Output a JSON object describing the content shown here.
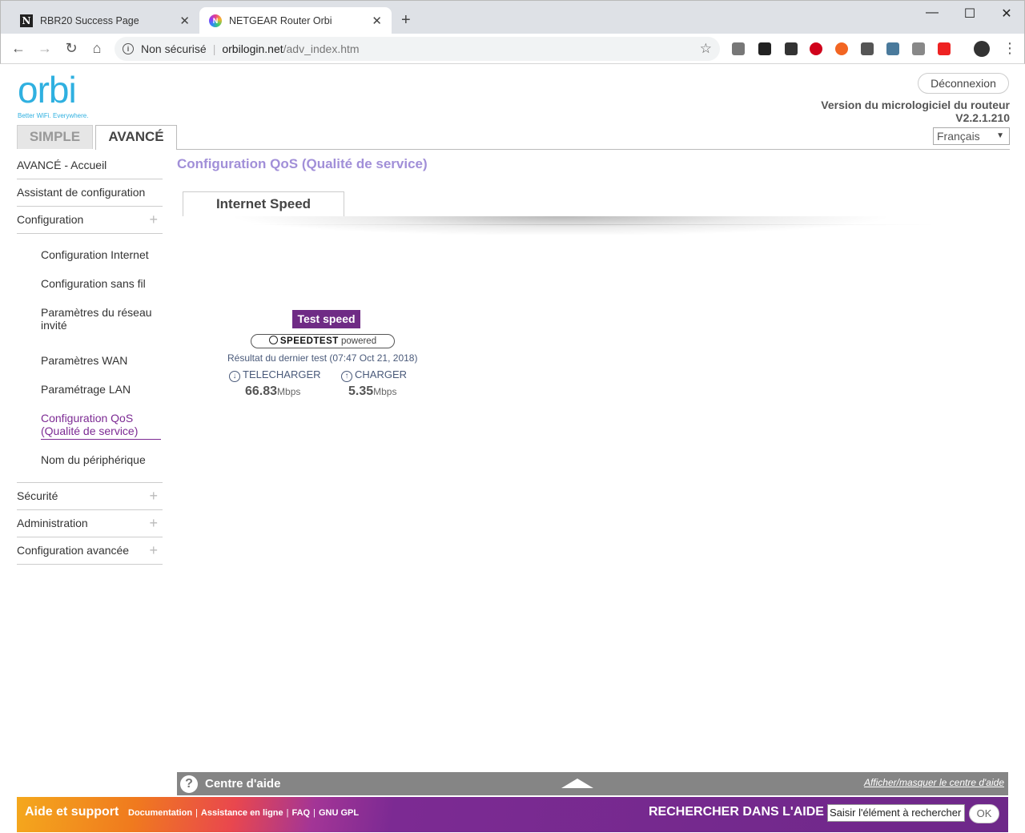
{
  "browser": {
    "tabs": [
      {
        "title": "RBR20 Success Page",
        "favicon": "notion-icon"
      },
      {
        "title": "NETGEAR Router Orbi",
        "favicon": "netgear-icon"
      }
    ],
    "security": "Non sécurisé",
    "url_host": "orbilogin.net",
    "url_path": "/adv_index.htm"
  },
  "header": {
    "logo": "orbi",
    "tagline": "Better WiFi. Everywhere.",
    "logout": "Déconnexion",
    "firmware_label": "Version du micrologiciel du routeur",
    "firmware_version": "V2.2.1.210",
    "language": "Français"
  },
  "mode_tabs": {
    "simple": "SIMPLE",
    "advanced": "AVANCÉ"
  },
  "sidebar": {
    "home": "AVANCÉ - Accueil",
    "wizard": "Assistant de configuration",
    "config": "Configuration",
    "sub": [
      "Configuration Internet",
      "Configuration sans fil",
      "Paramètres du réseau invité",
      "Paramètres WAN",
      "Paramétrage LAN",
      "Configuration QoS (Qualité de service)",
      "Nom du périphérique"
    ],
    "security": "Sécurité",
    "admin": "Administration",
    "advanced_config": "Configuration avancée"
  },
  "main": {
    "title": "Configuration QoS (Qualité de service)",
    "tab": "Internet Speed",
    "test_button": "Test speed",
    "speedtest_brand": "SPEEDTEST",
    "speedtest_powered": "powered",
    "last_result": "Résultat du dernier test (07:47 Oct 21, 2018)",
    "download_label": "TELECHARGER",
    "download_value": "66.83",
    "upload_label": "CHARGER",
    "upload_value": "5.35",
    "unit": "Mbps"
  },
  "helpbar": {
    "title": "Centre d'aide",
    "toggle": "Afficher/masquer le centre d'aide"
  },
  "footer": {
    "aide": "Aide et support",
    "links": [
      "Documentation",
      "Assistance en ligne",
      "FAQ",
      "GNU GPL"
    ],
    "search_label": "RECHERCHER DANS L'AIDE",
    "search_value": "Saisir l'élément à rechercher",
    "ok": "OK"
  },
  "colors": {
    "accent_purple": "#6f2b85",
    "title_lavender": "#a18fd8",
    "orbi_blue": "#2fb0e0"
  }
}
